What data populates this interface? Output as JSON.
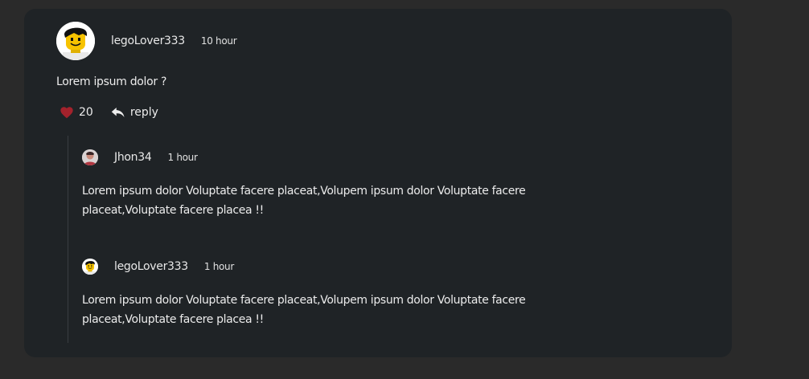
{
  "comment": {
    "username": "legoLover333",
    "time": "10 hour",
    "text": "Lorem ipsum dolor ?",
    "likes": "20",
    "reply_label": "reply",
    "avatar_icon": "lego-avatar-icon"
  },
  "replies": [
    {
      "username": "Jhon34",
      "time": "1 hour",
      "text": "Lorem ipsum dolor Voluptate facere placeat,Volupem ipsum dolor Voluptate facere placeat,Voluptate facere placea !!",
      "avatar_icon": "user-photo-avatar"
    },
    {
      "username": "legoLover333",
      "time": "1 hour",
      "text": "Lorem ipsum dolor Voluptate facere placeat,Volupem ipsum dolor Voluptate facere placeat,Voluptate facere placea !!",
      "avatar_icon": "lego-avatar-icon"
    }
  ],
  "colors": {
    "background": "#2a2a2a",
    "card": "#1f2326",
    "heart": "#a3222c"
  }
}
